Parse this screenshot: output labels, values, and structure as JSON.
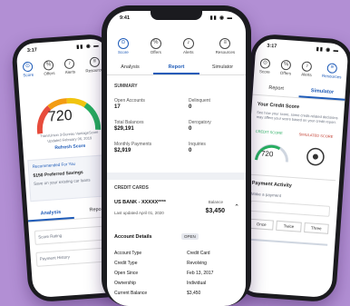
{
  "left_phone": {
    "time": "3:17",
    "nav": [
      "Score",
      "Offers",
      "Alerts",
      "Resources"
    ],
    "score": "720",
    "score_note_1": "TransUnion 3-Bureau VantageScore",
    "score_note_2": "Updated February 06, 2019",
    "refresh_label": "Refresh Score",
    "recommended_label": "Recommended For You",
    "promo_title": "$150 Preferred Savings",
    "promo_text": "Save on your existing car loans",
    "tabs": [
      "Analysis",
      "Report"
    ],
    "fields": [
      "Score Rating",
      "Payment History"
    ]
  },
  "center_phone": {
    "time": "9:41",
    "nav": [
      "Score",
      "Offers",
      "Alerts",
      "Resources"
    ],
    "tabs": [
      "Analysis",
      "Report",
      "Simulator"
    ],
    "summary_label": "SUMMARY",
    "summary": [
      {
        "label": "Open Accounts",
        "value": "17",
        "label2": "Delinquent",
        "value2": "0"
      },
      {
        "label": "Total Balances",
        "value": "$29,191",
        "label2": "Derogatory",
        "value2": "0"
      },
      {
        "label": "Monthly Payments",
        "value": "$2,919",
        "label2": "Inquiries",
        "value2": "0"
      }
    ],
    "credit_cards_label": "CREDIT CARDS",
    "card_name": "US BANK - XXXXX****",
    "card_updated": "Last updated April 01, 2020",
    "balance_label": "Balance",
    "balance_value": "$3,450",
    "account_details_label": "Account Details",
    "account_status": "OPEN",
    "details": [
      {
        "label": "Account Type",
        "value": "Credit Card"
      },
      {
        "label": "Credit Type",
        "value": "Revolving"
      },
      {
        "label": "Open Since",
        "value": "Feb 13, 2017"
      },
      {
        "label": "Ownership",
        "value": "Individual"
      },
      {
        "label": "Current Balance",
        "value": "$3,450"
      }
    ]
  },
  "right_phone": {
    "time": "3:17",
    "nav": [
      "Score",
      "Offers",
      "Alerts",
      "Resources"
    ],
    "tabs": [
      "Report",
      "Simulator"
    ],
    "section_title": "Your Credit Score",
    "section_text": "See how your score, some credit-related decisions may affect your score based on your credit report.",
    "gauge_1_label": "CREDIT SCORE",
    "gauge_1_value": "720",
    "gauge_2_label": "SIMULATED SCORE",
    "activity_title": "Payment Activity",
    "activity_text": "Make a payment",
    "buttons": [
      "Once",
      "Twice",
      "Three"
    ]
  },
  "colors": {
    "background": "#b28fd4",
    "accent": "#1e5bb8",
    "phone": "#1b1b1f"
  }
}
